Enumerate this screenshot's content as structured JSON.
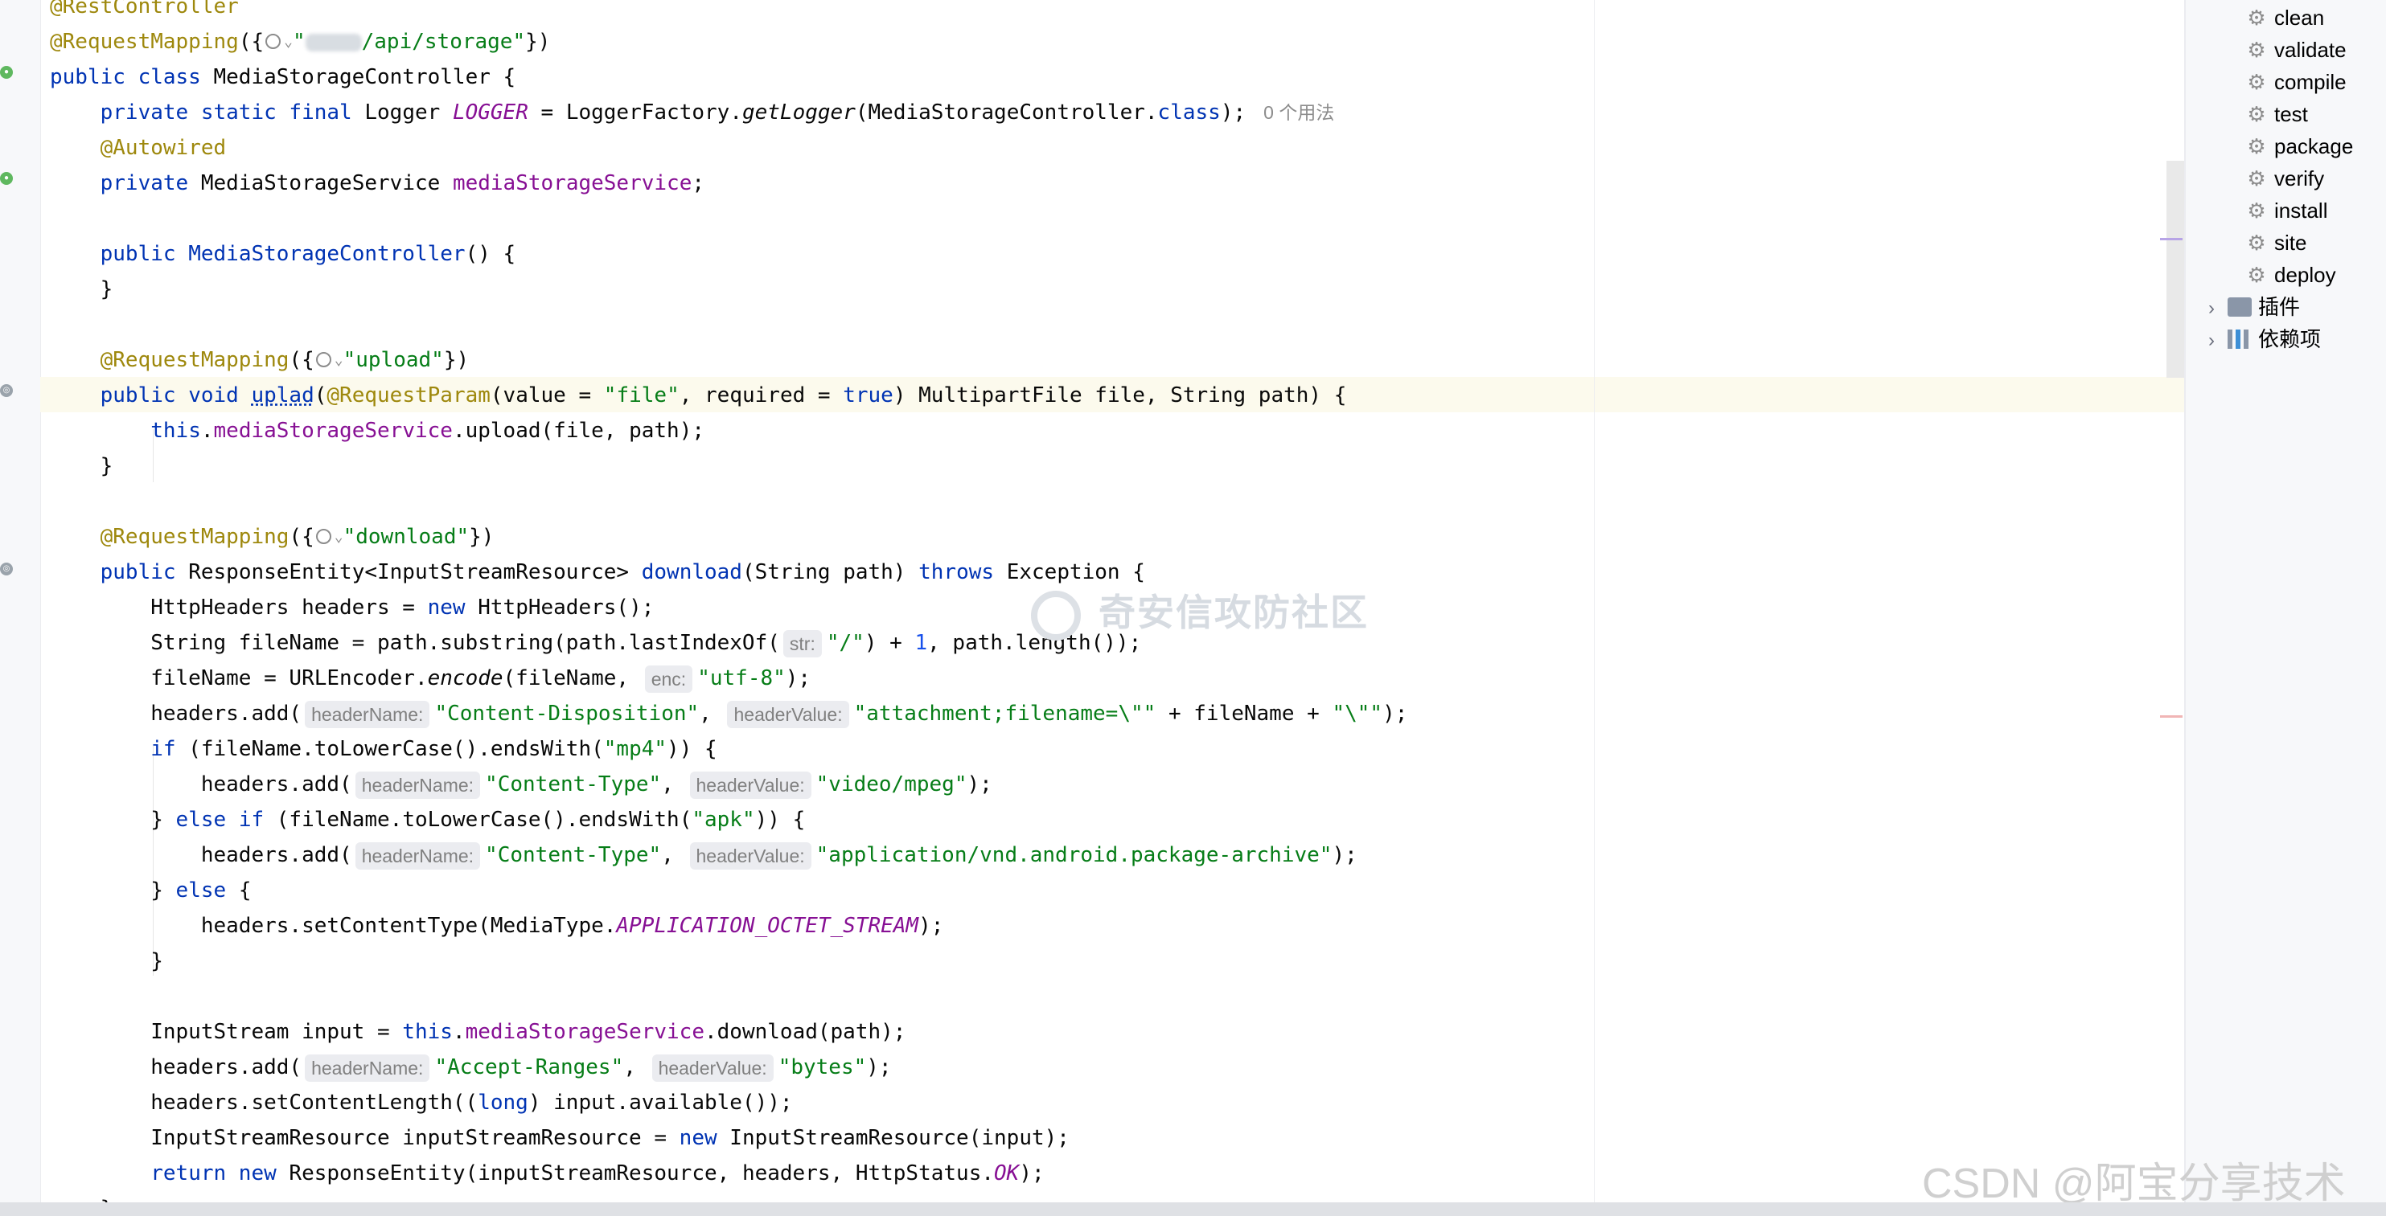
{
  "editor": {
    "lines": [
      {
        "id": "l0",
        "parts": [
          {
            "t": "@RestController",
            "c": "an"
          }
        ]
      },
      {
        "id": "l1",
        "parts": [
          {
            "t": "@RequestMapping",
            "c": "an"
          },
          {
            "t": "({",
            "c": ""
          },
          {
            "icon": "globe"
          },
          {
            "t": "\"",
            "c": "st"
          },
          {
            "redacted": true
          },
          {
            "t": "/api/storage\"",
            "c": "st"
          },
          {
            "t": "})",
            "c": ""
          }
        ]
      },
      {
        "id": "l2",
        "parts": [
          {
            "t": "public class ",
            "c": "kw"
          },
          {
            "t": "MediaStorageController {",
            "c": ""
          }
        ]
      },
      {
        "id": "l3",
        "parts": [
          {
            "t": "    "
          },
          {
            "t": "private static final ",
            "c": "kw"
          },
          {
            "t": "Logger ",
            "c": ""
          },
          {
            "t": "LOGGER",
            "c": "fdi"
          },
          {
            "t": " = LoggerFactory.",
            "c": ""
          },
          {
            "t": "getLogger",
            "c": "it"
          },
          {
            "t": "(MediaStorageController.",
            "c": ""
          },
          {
            "t": "class",
            "c": "kw"
          },
          {
            "t": ");",
            "c": ""
          },
          {
            "usage": "0 个用法"
          }
        ]
      },
      {
        "id": "l4",
        "parts": [
          {
            "t": "    "
          },
          {
            "t": "@Autowired",
            "c": "an"
          }
        ]
      },
      {
        "id": "l5",
        "parts": [
          {
            "t": "    "
          },
          {
            "t": "private ",
            "c": "kw"
          },
          {
            "t": "MediaStorageService ",
            "c": ""
          },
          {
            "t": "mediaStorageService",
            "c": "fd"
          },
          {
            "t": ";",
            "c": ""
          }
        ]
      },
      {
        "id": "l6",
        "parts": []
      },
      {
        "id": "l7",
        "parts": [
          {
            "t": "    "
          },
          {
            "t": "public ",
            "c": "kw"
          },
          {
            "t": "MediaStorageController",
            "c": "kw"
          },
          {
            "t": "() {",
            "c": ""
          }
        ]
      },
      {
        "id": "l8",
        "parts": [
          {
            "t": "    }"
          }
        ]
      },
      {
        "id": "l9",
        "parts": []
      },
      {
        "id": "l10",
        "parts": [
          {
            "t": "    "
          },
          {
            "t": "@RequestMapping",
            "c": "an"
          },
          {
            "t": "({",
            "c": ""
          },
          {
            "icon": "globe"
          },
          {
            "t": "\"upload\"",
            "c": "st"
          },
          {
            "t": "})",
            "c": ""
          }
        ]
      },
      {
        "id": "l11",
        "parts": [
          {
            "t": "    "
          },
          {
            "t": "public void ",
            "c": "kw"
          },
          {
            "t": "uplad",
            "c": "kw ul"
          },
          {
            "t": "(",
            "c": ""
          },
          {
            "t": "@RequestParam",
            "c": "an"
          },
          {
            "t": "(value = ",
            "c": ""
          },
          {
            "t": "\"file\"",
            "c": "st"
          },
          {
            "t": ", required = ",
            "c": ""
          },
          {
            "t": "true",
            "c": "kw"
          },
          {
            "t": ") MultipartFile file, String path) {",
            "c": ""
          }
        ]
      },
      {
        "id": "l12",
        "parts": [
          {
            "t": "        "
          },
          {
            "t": "this",
            "c": "kw"
          },
          {
            "t": ".",
            "c": ""
          },
          {
            "t": "mediaStorageService",
            "c": "fd"
          },
          {
            "t": ".upload(file, path);",
            "c": ""
          }
        ]
      },
      {
        "id": "l13",
        "parts": [
          {
            "t": "    }"
          }
        ]
      },
      {
        "id": "l14",
        "parts": []
      },
      {
        "id": "l15",
        "parts": [
          {
            "t": "    "
          },
          {
            "t": "@RequestMapping",
            "c": "an"
          },
          {
            "t": "({",
            "c": ""
          },
          {
            "icon": "globe"
          },
          {
            "t": "\"download\"",
            "c": "st"
          },
          {
            "t": "})",
            "c": ""
          }
        ]
      },
      {
        "id": "l16",
        "parts": [
          {
            "t": "    "
          },
          {
            "t": "public ",
            "c": "kw"
          },
          {
            "t": "ResponseEntity<InputStreamResource> ",
            "c": ""
          },
          {
            "t": "download",
            "c": "kw"
          },
          {
            "t": "(String path) ",
            "c": ""
          },
          {
            "t": "throws ",
            "c": "kw"
          },
          {
            "t": "Exception {",
            "c": ""
          }
        ]
      },
      {
        "id": "l17",
        "parts": [
          {
            "t": "        HttpHeaders headers = "
          },
          {
            "t": "new ",
            "c": "kw"
          },
          {
            "t": "HttpHeaders();",
            "c": ""
          }
        ]
      },
      {
        "id": "l18",
        "parts": [
          {
            "t": "        String fileName = path.substring(path.lastIndexOf("
          },
          {
            "hint": "str:"
          },
          {
            "t": "\"/\"",
            "c": "st"
          },
          {
            "t": ") + ",
            "c": ""
          },
          {
            "t": "1",
            "c": "num"
          },
          {
            "t": ", path.length());",
            "c": ""
          }
        ]
      },
      {
        "id": "l19",
        "parts": [
          {
            "t": "        fileName = URLEncoder."
          },
          {
            "t": "encode",
            "c": "it"
          },
          {
            "t": "(fileName, ",
            "c": ""
          },
          {
            "hint": "enc:"
          },
          {
            "t": "\"utf-8\"",
            "c": "st"
          },
          {
            "t": ");",
            "c": ""
          }
        ]
      },
      {
        "id": "l20",
        "parts": [
          {
            "t": "        headers.add("
          },
          {
            "hint": "headerName:"
          },
          {
            "t": "\"Content-Disposition\"",
            "c": "st"
          },
          {
            "t": ", ",
            "c": ""
          },
          {
            "hint": "headerValue:"
          },
          {
            "t": "\"attachment;filename=\\\"\"",
            "c": "st"
          },
          {
            "t": " + fileName + ",
            "c": ""
          },
          {
            "t": "\"\\\"\"",
            "c": "st"
          },
          {
            "t": ");",
            "c": ""
          }
        ]
      },
      {
        "id": "l21",
        "parts": [
          {
            "t": "        "
          },
          {
            "t": "if ",
            "c": "kw"
          },
          {
            "t": "(fileName.toLowerCase().endsWith(",
            "c": ""
          },
          {
            "t": "\"mp4\"",
            "c": "st"
          },
          {
            "t": ")) {",
            "c": ""
          }
        ]
      },
      {
        "id": "l22",
        "parts": [
          {
            "t": "            headers.add("
          },
          {
            "hint": "headerName:"
          },
          {
            "t": "\"Content-Type\"",
            "c": "st"
          },
          {
            "t": ", ",
            "c": ""
          },
          {
            "hint": "headerValue:"
          },
          {
            "t": "\"video/mpeg\"",
            "c": "st"
          },
          {
            "t": ");",
            "c": ""
          }
        ]
      },
      {
        "id": "l23",
        "parts": [
          {
            "t": "        } "
          },
          {
            "t": "else if ",
            "c": "kw"
          },
          {
            "t": "(fileName.toLowerCase().endsWith(",
            "c": ""
          },
          {
            "t": "\"apk\"",
            "c": "st"
          },
          {
            "t": ")) {",
            "c": ""
          }
        ]
      },
      {
        "id": "l24",
        "parts": [
          {
            "t": "            headers.add("
          },
          {
            "hint": "headerName:"
          },
          {
            "t": "\"Content-Type\"",
            "c": "st"
          },
          {
            "t": ", ",
            "c": ""
          },
          {
            "hint": "headerValue:"
          },
          {
            "t": "\"application/vnd.android.package-archive\"",
            "c": "st"
          },
          {
            "t": ");",
            "c": ""
          }
        ]
      },
      {
        "id": "l25",
        "parts": [
          {
            "t": "        } "
          },
          {
            "t": "else ",
            "c": "kw"
          },
          {
            "t": "{",
            "c": ""
          }
        ]
      },
      {
        "id": "l26",
        "parts": [
          {
            "t": "            headers.setContentType(MediaType."
          },
          {
            "t": "APPLICATION_OCTET_STREAM",
            "c": "fdi"
          },
          {
            "t": ");",
            "c": ""
          }
        ]
      },
      {
        "id": "l27",
        "parts": [
          {
            "t": "        }"
          }
        ]
      },
      {
        "id": "l28",
        "parts": []
      },
      {
        "id": "l29",
        "parts": [
          {
            "t": "        InputStream input = "
          },
          {
            "t": "this",
            "c": "kw"
          },
          {
            "t": ".",
            "c": ""
          },
          {
            "t": "mediaStorageService",
            "c": "fd"
          },
          {
            "t": ".download(path);",
            "c": ""
          }
        ]
      },
      {
        "id": "l30",
        "parts": [
          {
            "t": "        headers.add("
          },
          {
            "hint": "headerName:"
          },
          {
            "t": "\"Accept-Ranges\"",
            "c": "st"
          },
          {
            "t": ", ",
            "c": ""
          },
          {
            "hint": "headerValue:"
          },
          {
            "t": "\"bytes\"",
            "c": "st"
          },
          {
            "t": ");",
            "c": ""
          }
        ]
      },
      {
        "id": "l31",
        "parts": [
          {
            "t": "        headers.setContentLength(("
          },
          {
            "t": "long",
            "c": "kw"
          },
          {
            "t": ") input.available());",
            "c": ""
          }
        ]
      },
      {
        "id": "l32",
        "parts": [
          {
            "t": "        InputStreamResource inputStreamResource = "
          },
          {
            "t": "new ",
            "c": "kw"
          },
          {
            "t": "InputStreamResource(input);",
            "c": ""
          }
        ]
      },
      {
        "id": "l33",
        "parts": [
          {
            "t": "        "
          },
          {
            "t": "return new ",
            "c": "kw"
          },
          {
            "t": "ResponseEntity(inputStreamResource, headers, HttpStatus.",
            "c": ""
          },
          {
            "t": "OK",
            "c": "fdi"
          },
          {
            "t": ");",
            "c": ""
          }
        ]
      },
      {
        "id": "l34",
        "parts": [
          {
            "t": "    }"
          }
        ]
      }
    ],
    "colors": {
      "keyword": "#0033b3",
      "annotation": "#9e880d",
      "string": "#067d17",
      "field": "#871094",
      "number": "#1750eb",
      "hint_bg": "#ebecf0",
      "current_line": "#fcfaed"
    }
  },
  "watermark": {
    "center": "奇安信攻防社区",
    "footer": "CSDN @阿宝分享技术"
  },
  "maven_panel": {
    "lifecycle": [
      {
        "label": "clean",
        "icon": "gear-icon"
      },
      {
        "label": "validate",
        "icon": "gear-icon"
      },
      {
        "label": "compile",
        "icon": "gear-icon"
      },
      {
        "label": "test",
        "icon": "gear-icon"
      },
      {
        "label": "package",
        "icon": "gear-icon"
      },
      {
        "label": "verify",
        "icon": "gear-icon"
      },
      {
        "label": "install",
        "icon": "gear-icon"
      },
      {
        "label": "site",
        "icon": "gear-icon"
      },
      {
        "label": "deploy",
        "icon": "gear-icon"
      }
    ],
    "groups": [
      {
        "label": "插件",
        "icon": "plugins-folder-icon"
      },
      {
        "label": "依赖项",
        "icon": "dependencies-icon"
      }
    ]
  }
}
